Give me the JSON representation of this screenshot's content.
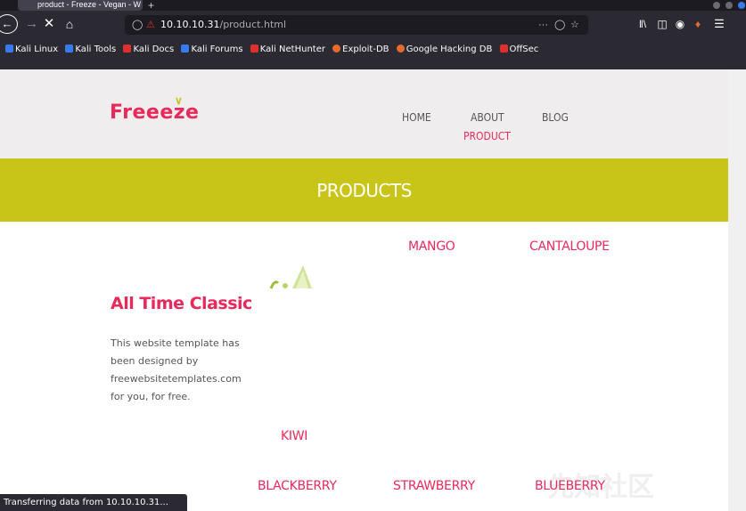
{
  "browser": {
    "tab_title": "product - Freeze - Vegan - W",
    "url_host": "10.10.10.31",
    "url_path": "/product.html",
    "bookmarks": [
      {
        "label": "Kali Linux",
        "color": "#367bf0"
      },
      {
        "label": "Kali Tools",
        "color": "#367bf0"
      },
      {
        "label": "Kali Docs",
        "color": "#e02f2f"
      },
      {
        "label": "Kali Forums",
        "color": "#367bf0"
      },
      {
        "label": "Kali NetHunter",
        "color": "#e02f2f"
      },
      {
        "label": "Exploit-DB",
        "color": "#e8692c"
      },
      {
        "label": "Google Hacking DB",
        "color": "#e8692c"
      },
      {
        "label": "OffSec",
        "color": "#e02f2f"
      }
    ],
    "status_text": "Transferring data from 10.10.10.31..."
  },
  "site": {
    "logo": "Freeeze",
    "menu": {
      "home": "HOME",
      "about": "ABOUT",
      "blog": "BLOG",
      "product": "PRODUCT"
    },
    "banner_title": "PRODUCTS",
    "sidebar": {
      "title": "All Time Classic",
      "text": "This website template has been designed by freewebsitetemplates.com for you, for free."
    },
    "products": {
      "mango": "MANGO",
      "cantaloupe": "CANTALOUPE",
      "kiwi": "KIWI",
      "blackberry": "BLACKBERRY",
      "strawberry": "STRAWBERRY",
      "blueberry": "BLUEBERRY"
    },
    "colors": {
      "accent": "#e8295b",
      "banner": "#c9c518",
      "header_bg": "#efedee"
    }
  },
  "watermark": "先知社区"
}
